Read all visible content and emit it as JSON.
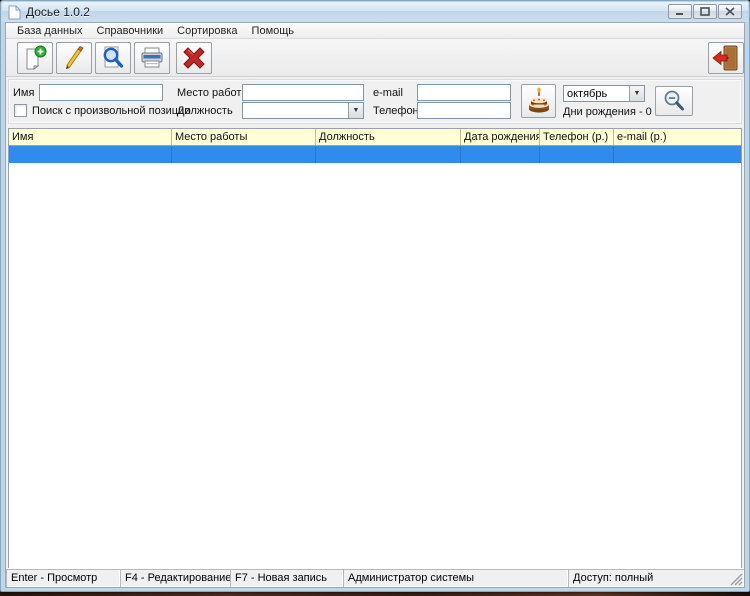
{
  "window": {
    "title": "Досье 1.0.2"
  },
  "menu": {
    "items": [
      "База данных",
      "Справочники",
      "Сортировка",
      "Помощь"
    ]
  },
  "toolbar": {
    "icons": [
      "new-record-icon",
      "edit-record-icon",
      "view-search-icon",
      "print-icon",
      "delete-record-icon",
      "exit-icon"
    ]
  },
  "search": {
    "name_label": "Имя",
    "name_value": "",
    "workplace_label": "Место работы",
    "workplace_value": "",
    "email_label": "e-mail",
    "email_value": "",
    "anyposition_checkbox_label": "Поиск с произвольной позиции",
    "position_label": "Должность",
    "position_value": "",
    "phone_label": "Телефон",
    "phone_value": "",
    "month_value": "октябрь",
    "birthdays_label": "Дни рождения - 0",
    "cake_icon": "birthday-cake-icon",
    "zoom_icon": "magnifier-minus-icon"
  },
  "table": {
    "columns": [
      "Имя",
      "Место работы",
      "Должность",
      "Дата рождения",
      "Телефон (р.)",
      "e-mail (р.)"
    ],
    "rows": [],
    "selected_row_color": "#2f8ced",
    "header_color": "#ffffd7"
  },
  "statusbar": {
    "panels": [
      "Enter - Просмотр",
      "F4 - Редактирование",
      "F7 - Новая запись",
      "Администратор системы",
      "Доступ: полный"
    ]
  }
}
